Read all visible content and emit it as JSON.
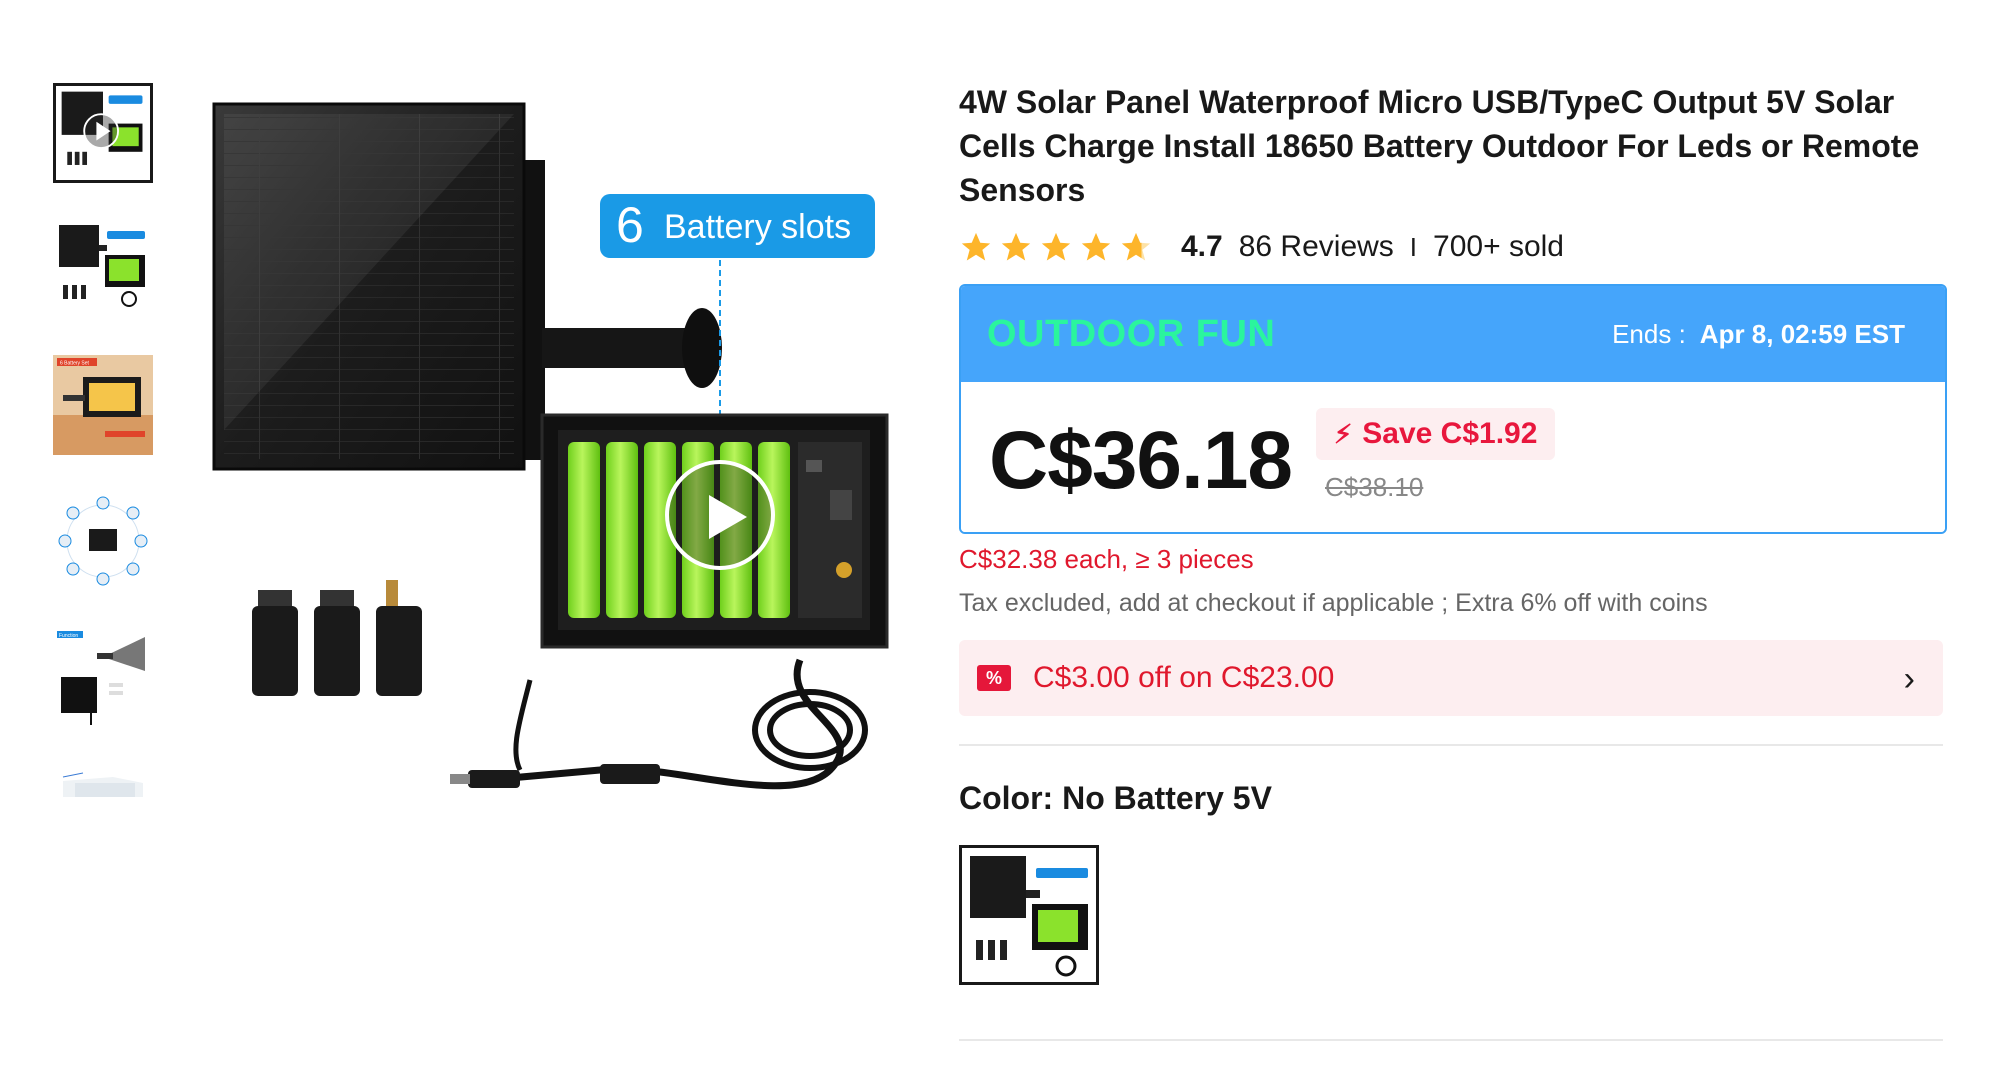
{
  "gallery": {
    "thumbnails": [
      {
        "name": "thumb-main-video",
        "active": true
      },
      {
        "name": "thumb-battery-slots"
      },
      {
        "name": "thumb-install-photo",
        "caption": "6 Battery Set"
      },
      {
        "name": "thumb-accessories"
      },
      {
        "name": "thumb-function",
        "caption": "Function"
      },
      {
        "name": "thumb-partial"
      }
    ],
    "main_image_callout": {
      "number": "6",
      "text": "Battery slots"
    }
  },
  "product": {
    "title": "4W Solar Panel Waterproof Micro USB/TypeC Output 5V Solar Cells Charge Install 18650 Battery Outdoor For Leds or Remote Sensors",
    "rating": "4.7",
    "stars": 4.7,
    "reviews": "86 Reviews",
    "separator": "I",
    "sold": "700+ sold"
  },
  "promo": {
    "name": "OUTDOOR FUN",
    "ends_label": "Ends :",
    "ends_value": "Apr 8, 02:59 EST",
    "price": "C$36.18",
    "save": "Save C$1.92",
    "original_price": "C$38.10",
    "header_color": "#45a5fb",
    "name_color": "#2af59d"
  },
  "bulk_price": "C$32.38 each, ≥ 3 pieces",
  "tax_note": "Tax excluded, add at checkout if applicable ; Extra 6% off with coins",
  "coupon": {
    "icon": "%",
    "text": "C$3.00 off on C$23.00",
    "arrow": "›"
  },
  "color": {
    "label": "Color: ",
    "value": "No Battery 5V"
  }
}
